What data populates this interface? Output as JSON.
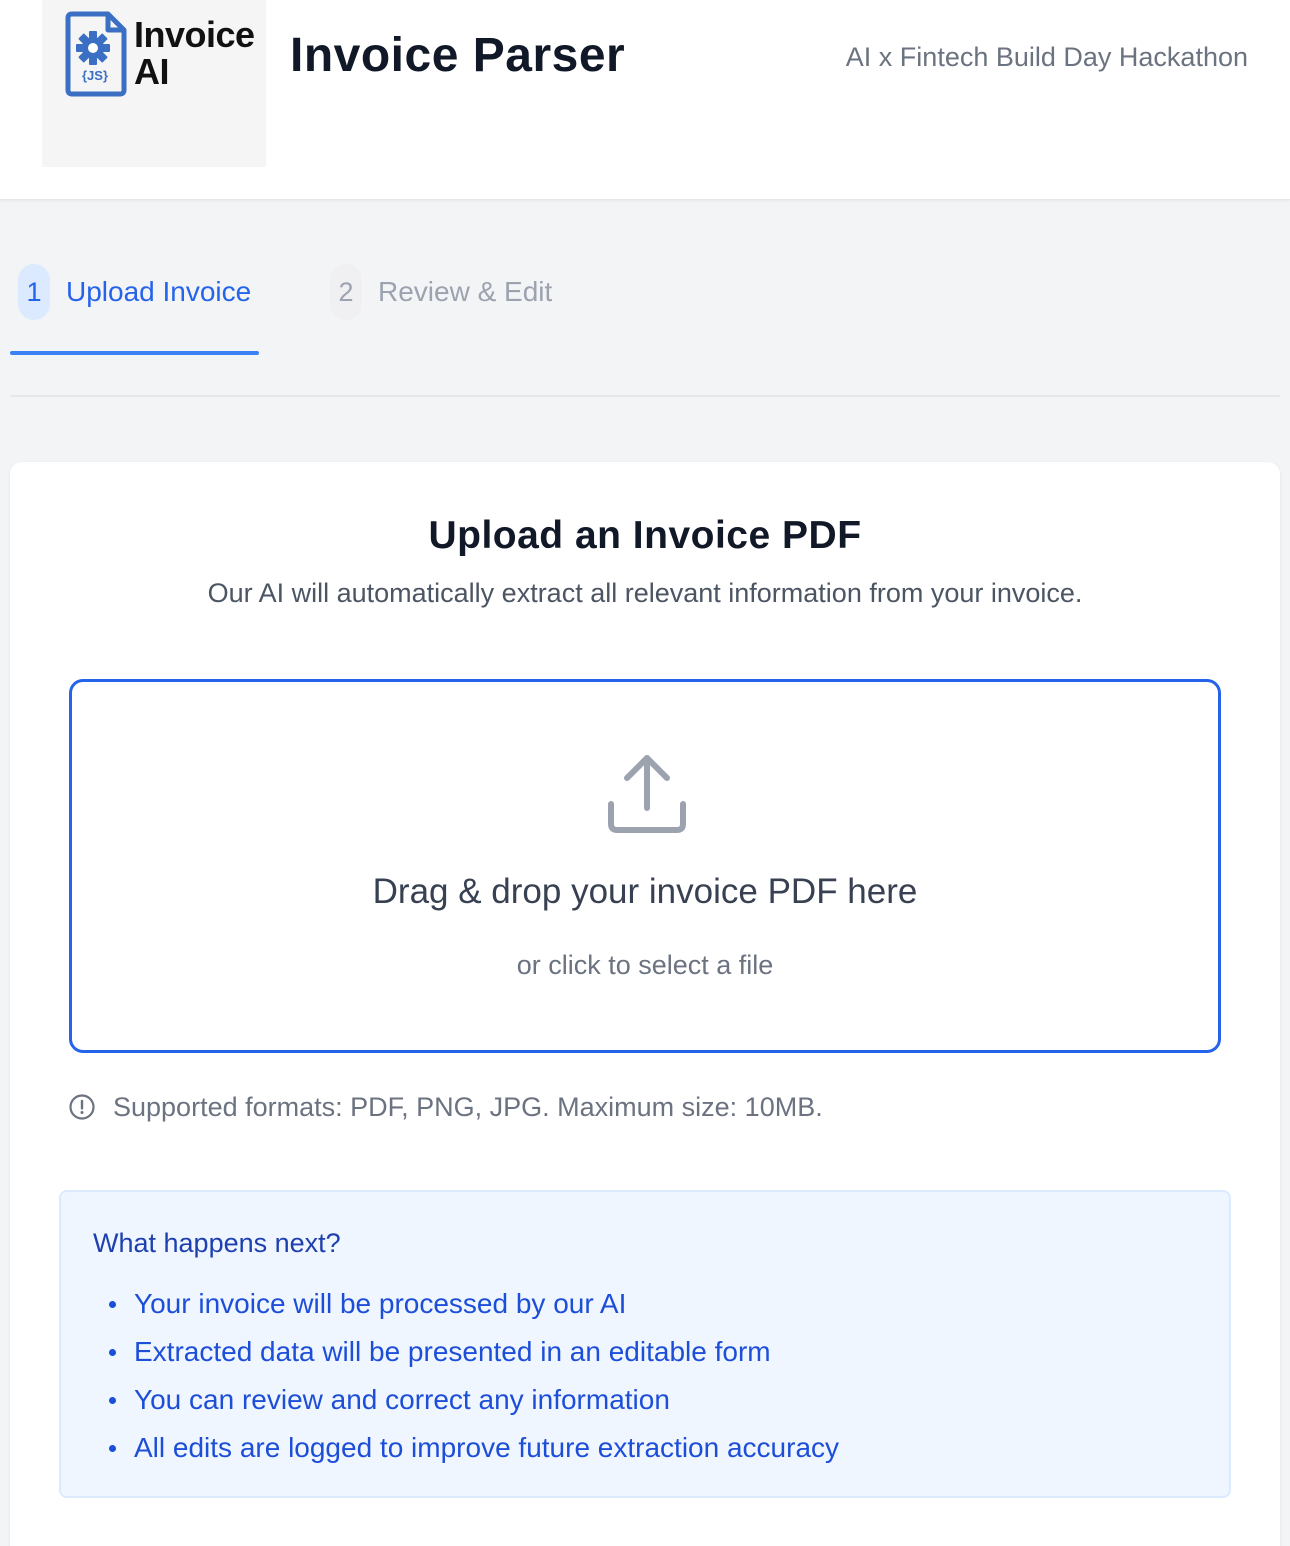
{
  "header": {
    "logo_line1": "Invoice",
    "logo_line2": "AI",
    "logo_badge": "{JS}",
    "title": "Invoice Parser",
    "event": "AI x Fintech Build Day Hackathon"
  },
  "tabs": [
    {
      "number": "1",
      "label": "Upload Invoice",
      "active": true
    },
    {
      "number": "2",
      "label": "Review & Edit",
      "active": false
    }
  ],
  "upload": {
    "title": "Upload an Invoice PDF",
    "subtitle": "Our AI will automatically extract all relevant information from your invoice.",
    "drop_main": "Drag & drop your invoice PDF here",
    "drop_sub": "or click to select a file",
    "formats_note": "Supported formats: PDF, PNG, JPG. Maximum size: 10MB."
  },
  "next": {
    "title": "What happens next?",
    "items": [
      "Your invoice will be processed by our AI",
      "Extracted data will be presented in an editable form",
      "You can review and correct any information",
      "All edits are logged to improve future extraction accuracy"
    ]
  },
  "colors": {
    "accent": "#2563eb",
    "logo_blue": "#3b6fc4",
    "info_bg": "#eff6ff",
    "info_text": "#1d4ed8"
  },
  "icons": {
    "logo": "document-gear-icon",
    "upload": "upload-icon",
    "info": "info-circle-icon"
  }
}
